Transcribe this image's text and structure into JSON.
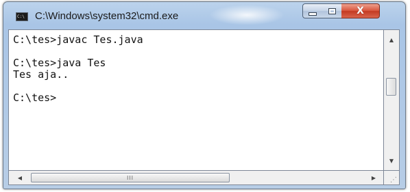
{
  "window": {
    "title": "C:\\Windows\\system32\\cmd.exe",
    "icon": "cmd-icon",
    "icon_label": "C:\\"
  },
  "caption_buttons": {
    "minimize_icon": "minimize-icon",
    "maximize_icon": "maximize-icon",
    "close_icon": "close-icon",
    "close_glyph": "X"
  },
  "console": {
    "lines": [
      "C:\\tes>javac Tes.java",
      "",
      "C:\\tes>java Tes",
      "Tes aja..",
      "",
      "C:\\tes>"
    ]
  },
  "scrollbars": {
    "up_arrow": "▲",
    "down_arrow": "▼",
    "left_arrow": "◀",
    "right_arrow": "▶",
    "thumb_grip": "III"
  },
  "colors": {
    "close_red": "#c8432b",
    "frame_blue": "#a9c5e6",
    "console_bg": "#ffffff",
    "console_fg": "#111111"
  }
}
